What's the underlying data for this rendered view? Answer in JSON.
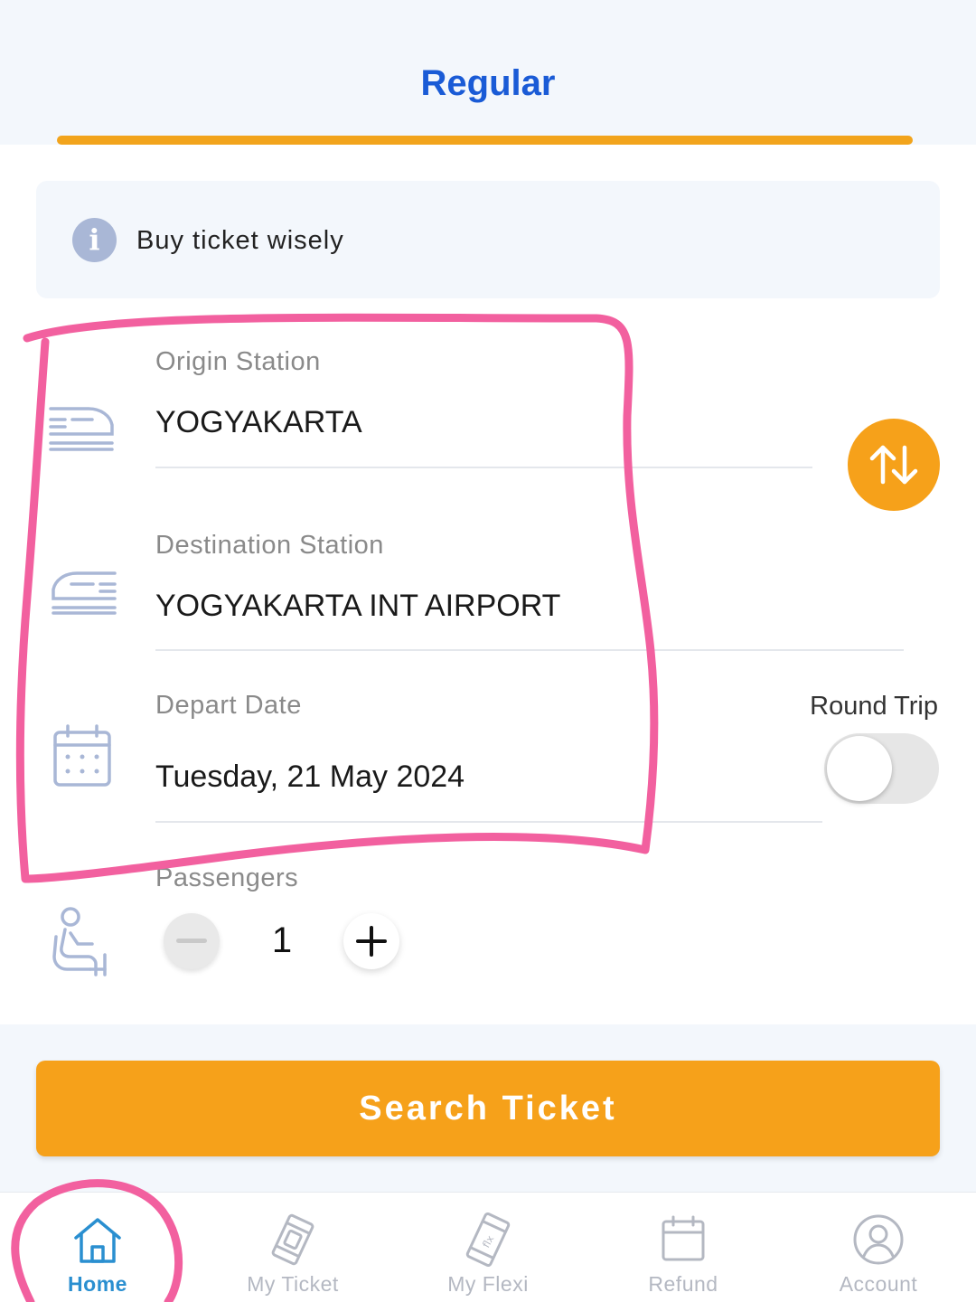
{
  "header": {
    "tab_label": "Regular"
  },
  "info": {
    "text": "Buy ticket wisely",
    "icon": "info-icon"
  },
  "form": {
    "origin_label": "Origin Station",
    "origin_value": "YOGYAKARTA",
    "destination_label": "Destination Station",
    "destination_value": "YOGYAKARTA INT AIRPORT",
    "depart_label": "Depart Date",
    "depart_value": "Tuesday, 21 May 2024",
    "round_trip_label": "Round Trip",
    "round_trip_enabled": false,
    "passengers_label": "Passengers",
    "passengers_value": "1"
  },
  "search": {
    "button_label": "Search Ticket"
  },
  "nav": {
    "items": [
      {
        "label": "Home",
        "icon": "home-icon",
        "active": true
      },
      {
        "label": "My Ticket",
        "icon": "ticket-icon",
        "active": false
      },
      {
        "label": "My Flexi",
        "icon": "flexi-icon",
        "active": false
      },
      {
        "label": "Refund",
        "icon": "calendar-icon",
        "active": false
      },
      {
        "label": "Account",
        "icon": "account-icon",
        "active": false
      }
    ]
  },
  "colors": {
    "accent_orange": "#f6a11a",
    "tab_blue": "#1a5bd6",
    "active_nav_blue": "#2a8fd0",
    "annotation_pink": "#f2609f"
  }
}
